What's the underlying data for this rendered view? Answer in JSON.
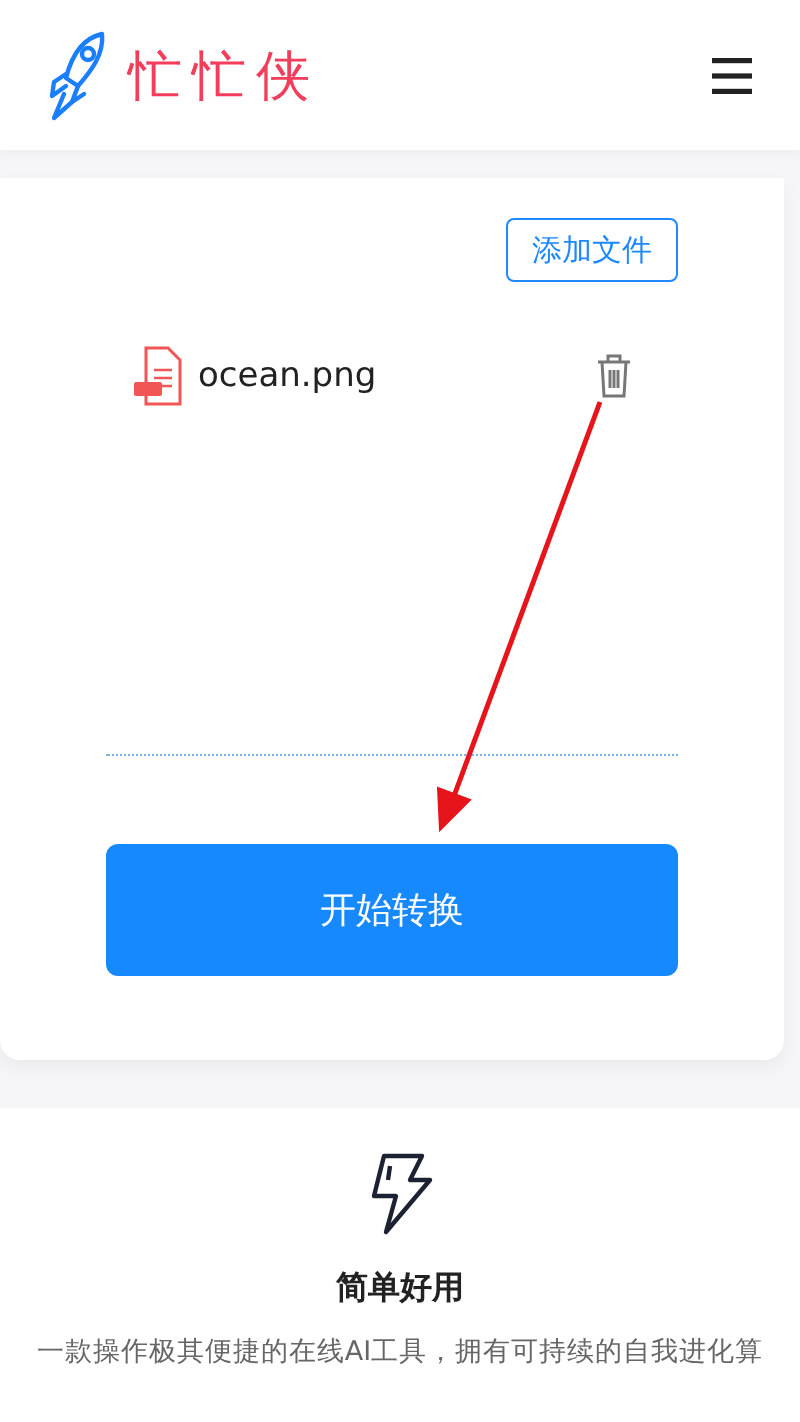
{
  "header": {
    "logo_text": "忙忙侠"
  },
  "upload": {
    "add_button": "添加文件",
    "files": [
      {
        "name": "ocean.png"
      }
    ],
    "convert_button": "开始转换"
  },
  "feature": {
    "title": "简单好用",
    "description": "一款操作极其便捷的在线AI工具，拥有可持续的自我进化算"
  }
}
